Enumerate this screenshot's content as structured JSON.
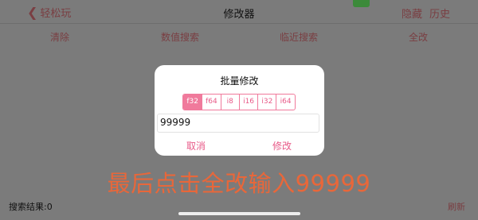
{
  "header": {
    "back_label": "轻松玩",
    "title": "修改器",
    "hide_label": "隐藏",
    "history_label": "历史"
  },
  "menu": {
    "items": [
      "清除",
      "数值搜索",
      "临近搜索",
      "全改"
    ]
  },
  "dialog": {
    "title": "批量修改",
    "types": [
      "f32",
      "f64",
      "i8",
      "i16",
      "i32",
      "i64"
    ],
    "active_type": "f32",
    "input_value": "99999",
    "cancel_label": "取消",
    "confirm_label": "修改"
  },
  "overlay": {
    "instruction": "最后点击全改输入99999"
  },
  "footer": {
    "result_label": "搜索结果:0",
    "refresh_label": "刷新"
  },
  "colors": {
    "accent": "#f07a9c",
    "instruction": "#e8673a",
    "dim_background": "#7b7b7b"
  }
}
